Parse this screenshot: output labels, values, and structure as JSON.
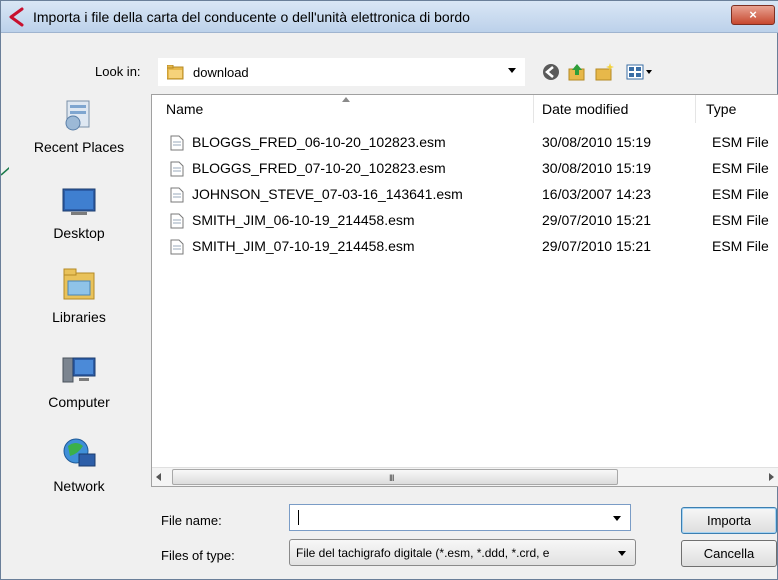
{
  "window": {
    "title": "Importa i file della carta del conducente o dell'unità elettronica di bordo",
    "close_label": "×"
  },
  "toolbar": {
    "lookin_label": "Look in:",
    "lookin_value": "download",
    "icons": [
      "back-icon",
      "up-folder-icon",
      "new-folder-icon",
      "views-menu-icon"
    ]
  },
  "places": [
    {
      "label": "Recent Places",
      "icon": "recent-places-icon"
    },
    {
      "label": "Desktop",
      "icon": "desktop-icon"
    },
    {
      "label": "Libraries",
      "icon": "libraries-icon"
    },
    {
      "label": "Computer",
      "icon": "computer-icon"
    },
    {
      "label": "Network",
      "icon": "network-icon"
    }
  ],
  "list": {
    "columns": [
      "Name",
      "Date modified",
      "Type"
    ],
    "rows": [
      {
        "name": "BLOGGS_FRED_06-10-20_102823.esm",
        "date": "30/08/2010 15:19",
        "type": "ESM File"
      },
      {
        "name": "BLOGGS_FRED_07-10-20_102823.esm",
        "date": "30/08/2010 15:19",
        "type": "ESM File"
      },
      {
        "name": "JOHNSON_STEVE_07-03-16_143641.esm",
        "date": "16/03/2007 14:23",
        "type": "ESM File"
      },
      {
        "name": "SMITH_JIM_06-10-19_214458.esm",
        "date": "29/07/2010 15:21",
        "type": "ESM File"
      },
      {
        "name": "SMITH_JIM_07-10-19_214458.esm",
        "date": "29/07/2010 15:21",
        "type": "ESM File"
      }
    ],
    "scroll_grip": "III"
  },
  "form": {
    "filename_label": "File name:",
    "filename_value": "",
    "filetype_label": "Files of type:",
    "filetype_value": "File del tachigrafo digitale (*.esm, *.ddd, *.crd, e"
  },
  "buttons": {
    "import": "Importa",
    "cancel": "Cancella"
  },
  "colors": {
    "title_gradient_top": "#d9e6f5",
    "title_gradient_bottom": "#bcd1ea",
    "close_red": "#c7482f",
    "annotation_arrow": "#1a7a4a"
  }
}
